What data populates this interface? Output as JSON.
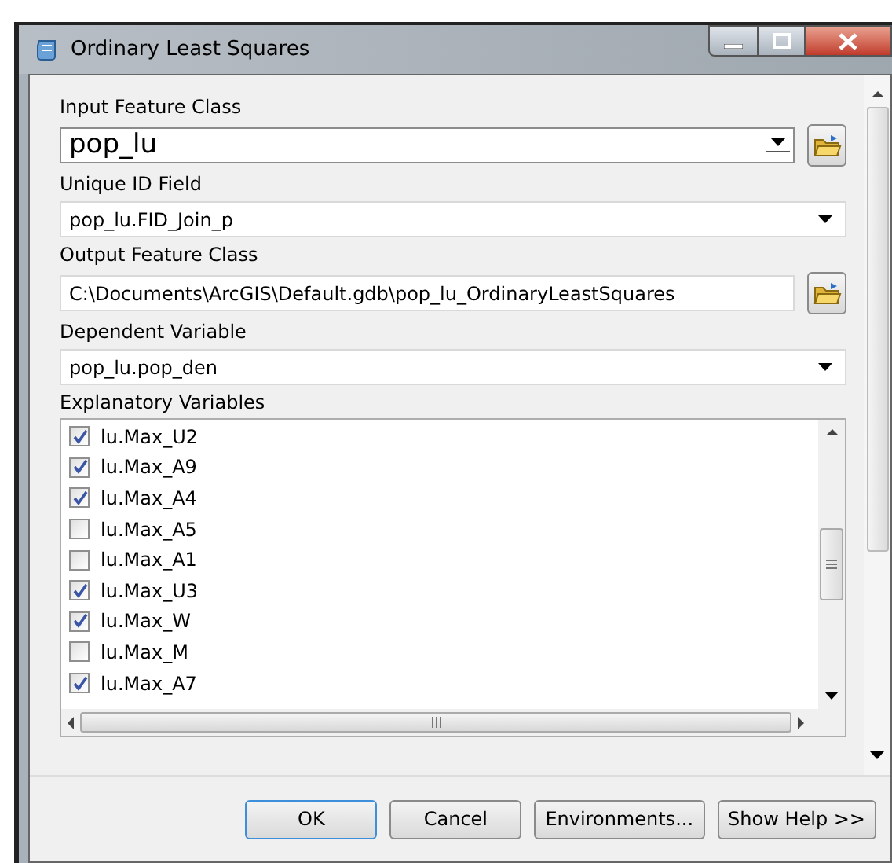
{
  "window": {
    "title": "Ordinary Least Squares"
  },
  "fields": [
    {
      "label": "Input Feature Class",
      "value": "pop_lu",
      "kind": "combo_browse",
      "large": true
    },
    {
      "label": "Unique ID Field",
      "value": "pop_lu.FID_Join_p",
      "kind": "dropdown",
      "large": false
    },
    {
      "label": "Output Feature Class",
      "value": "C:\\Documents\\ArcGIS\\Default.gdb\\pop_lu_OrdinaryLeastSquares",
      "kind": "text_browse",
      "large": false
    },
    {
      "label": "Dependent Variable",
      "value": "pop_lu.pop_den",
      "kind": "dropdown",
      "large": false
    }
  ],
  "explanatory": {
    "label": "Explanatory Variables",
    "items": [
      {
        "name": "lu.Max_U2",
        "checked": true
      },
      {
        "name": "lu.Max_A9",
        "checked": true
      },
      {
        "name": "lu.Max_A4",
        "checked": true
      },
      {
        "name": "lu.Max_A5",
        "checked": false
      },
      {
        "name": "lu.Max_A1",
        "checked": false
      },
      {
        "name": "lu.Max_U3",
        "checked": true
      },
      {
        "name": "lu.Max_W",
        "checked": true
      },
      {
        "name": "lu.Max_M",
        "checked": false
      },
      {
        "name": "lu.Max_A7",
        "checked": true
      }
    ]
  },
  "buttons": [
    {
      "label": "OK",
      "default": true
    },
    {
      "label": "Cancel",
      "default": false
    },
    {
      "label": "Environments...",
      "default": false
    },
    {
      "label": "Show Help >>",
      "default": false
    }
  ]
}
